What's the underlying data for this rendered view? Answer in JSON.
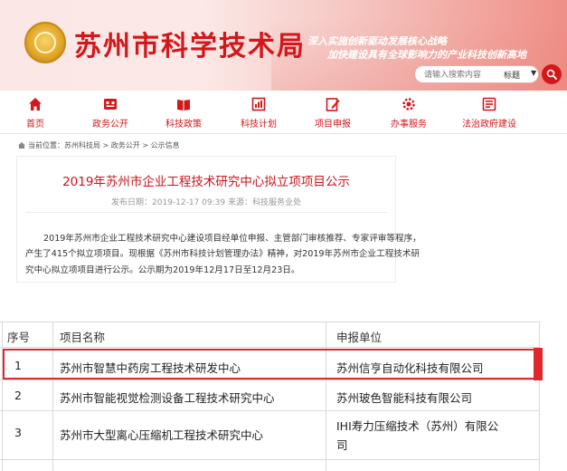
{
  "header": {
    "site_title": "苏州市科学技术局",
    "slogan_line1": "深入实施创新驱动发展核心战略",
    "slogan_line2": "加快建设具有全球影响力的产业科技创新高地",
    "search_placeholder": "请输入搜索内容",
    "search_type": "标题",
    "search_caret": "▼"
  },
  "nav": {
    "items": [
      {
        "label": "首页",
        "icon": "home-icon"
      },
      {
        "label": "政务公开",
        "icon": "open-affairs-icon"
      },
      {
        "label": "科技政策",
        "icon": "policy-book-icon"
      },
      {
        "label": "科技计划",
        "icon": "plan-chart-icon"
      },
      {
        "label": "项目申报",
        "icon": "edit-icon"
      },
      {
        "label": "办事服务",
        "icon": "service-gear-icon"
      },
      {
        "label": "法治政府建设",
        "icon": "law-scale-icon"
      }
    ]
  },
  "breadcrumb": {
    "text": "当前位置：苏州科技局 > 政务公开 > 公示信息"
  },
  "article": {
    "title": "2019年苏州市企业工程技术研究中心拟立项项目公示",
    "meta": "发布日期：2019-12-17 09:39 来源：科技服务业处",
    "para_line1": "2019年苏州市企业工程技术研究中心建设项目经单位申报、主管部门审核推荐、专家评审等程序，",
    "para_line2": "产生了415个拟立项项目。现根据《苏州市科技计划管理办法》精神，对2019年苏州市企业工程技术研",
    "para_line3": "究中心拟立项项目进行公示。公示期为2019年12月17日至12月23日。"
  },
  "table": {
    "headers": [
      "序号",
      "项目名称",
      "申报单位"
    ],
    "rows": [
      {
        "no": "1",
        "name": "苏州市智慧中药房工程技术研发中心",
        "unit": "苏州信亨自动化科技有限公司",
        "unit2": ""
      },
      {
        "no": "2",
        "name": "苏州市智能视觉检测设备工程技术研究中心",
        "unit": "苏州玻色智能科技有限公司",
        "unit2": ""
      },
      {
        "no": "3",
        "name": "苏州市大型离心压缩机工程技术研究中心",
        "unit": "IHI寿力压缩技术（苏州）有限公",
        "unit2": "司"
      }
    ]
  },
  "colors": {
    "brand_red": "#d3171b",
    "highlight_red": "#e0272b"
  }
}
